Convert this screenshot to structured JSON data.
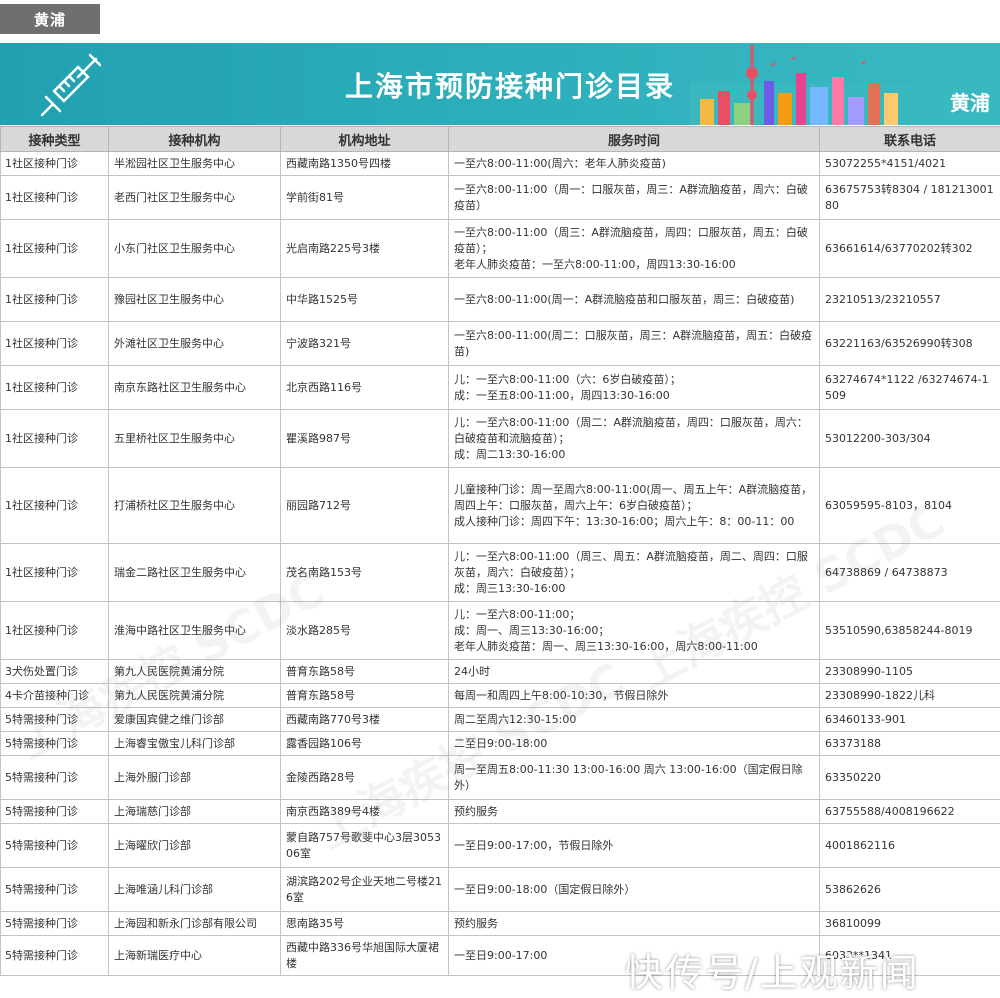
{
  "tab": {
    "label": "黄浦"
  },
  "banner": {
    "title": "上海市预防接种门诊目录",
    "district": "黄浦"
  },
  "table": {
    "headers": [
      "接种类型",
      "接种机构",
      "机构地址",
      "服务时间",
      "联系电话"
    ],
    "rows": [
      {
        "type": "1社区接种门诊",
        "org": "半淞园社区卫生服务中心",
        "addr": "西藏南路1350号四楼",
        "hours": "一至六8:00-11:00(周六：老年人肺炎疫苗)",
        "phone": "53072255*4151/4021"
      },
      {
        "type": "1社区接种门诊",
        "org": "老西门社区卫生服务中心",
        "addr": "学前街81号",
        "hours": "一至六8:00-11:00（周一：口服灰苗，周三：A群流脑疫苗，周六：白破疫苗）",
        "phone": "63675753转8304 / 18121300180"
      },
      {
        "type": "1社区接种门诊",
        "org": "小东门社区卫生服务中心",
        "addr": "光启南路225号3楼",
        "hours": "一至六8:00-11:00（周三：A群流脑疫苗，周四：口服灰苗，周五：白破疫苗）；\n老年人肺炎疫苗：一至六8:00-11:00，周四13:30-16:00",
        "phone": "63661614/63770202转302"
      },
      {
        "type": "1社区接种门诊",
        "org": "豫园社区卫生服务中心",
        "addr": "中华路1525号",
        "hours": "一至六8:00-11:00(周一：A群流脑疫苗和口服灰苗，周三：白破疫苗)",
        "phone": "23210513/23210557"
      },
      {
        "type": "1社区接种门诊",
        "org": "外滩社区卫生服务中心",
        "addr": "宁波路321号",
        "hours": "一至六8:00-11:00(周二：口服灰苗，周三：A群流脑疫苗，周五：白破疫苗)",
        "phone": "63221163/63526990转308"
      },
      {
        "type": "1社区接种门诊",
        "org": "南京东路社区卫生服务中心",
        "addr": "北京西路116号",
        "hours": "儿：一至六8:00-11:00（六：6岁白破疫苗）；\n成：一至五8:00-11:00，周四13:30-16:00",
        "phone": "63274674*1122 /63274674-1509"
      },
      {
        "type": "1社区接种门诊",
        "org": "五里桥社区卫生服务中心",
        "addr": "瞿溪路987号",
        "hours": "儿：一至六8:00-11:00（周二：A群流脑疫苗，周四：口服灰苗，周六：白破疫苗和流脑疫苗）；\n成：周二13:30-16:00",
        "phone": "53012200-303/304"
      },
      {
        "type": "1社区接种门诊",
        "org": "打浦桥社区卫生服务中心",
        "addr": "丽园路712号",
        "hours": "儿童接种门诊：周一至周六8:00-11:00(周一、周五上午：A群流脑疫苗，周四上午：口服灰苗，周六上午：6岁白破疫苗）；\n成人接种门诊：周四下午：13:30-16:00；周六上午：8：00-11：00",
        "phone": "63059595-8103，8104"
      },
      {
        "type": "1社区接种门诊",
        "org": "瑞金二路社区卫生服务中心",
        "addr": "茂名南路153号",
        "hours": "儿：一至六8:00-11:00（周三、周五：A群流脑疫苗，周二、周四：口服灰苗，周六：白破疫苗）；\n成：周三13:30-16:00",
        "phone": "64738869 / 64738873"
      },
      {
        "type": "1社区接种门诊",
        "org": "淮海中路社区卫生服务中心",
        "addr": "淡水路285号",
        "hours": "儿：一至六8:00-11:00；\n成：周一、周三13:30-16:00；\n老年人肺炎疫苗：周一、周三13:30-16:00，周六8:00-11:00",
        "phone": "53510590,63858244-8019"
      },
      {
        "type": "3犬伤处置门诊",
        "org": "第九人民医院黄浦分院",
        "addr": "普育东路58号",
        "hours": "24小时",
        "phone": "23308990-1105"
      },
      {
        "type": "4卡介苗接种门诊",
        "org": "第九人民医院黄浦分院",
        "addr": "普育东路58号",
        "hours": "每周一和周四上午8:00-10:30，节假日除外",
        "phone": "23308990-1822儿科"
      },
      {
        "type": "5特需接种门诊",
        "org": "爱康国宾健之维门诊部",
        "addr": "西藏南路770号3楼",
        "hours": "周二至周六12:30-15:00",
        "phone": "63460133-901"
      },
      {
        "type": "5特需接种门诊",
        "org": "上海睿宝傲宝儿科门诊部",
        "addr": "露香园路106号",
        "hours": "二至日9:00-18:00",
        "phone": "63373188"
      },
      {
        "type": "5特需接种门诊",
        "org": "上海外服门诊部",
        "addr": "金陵西路28号",
        "hours": "周一至周五8:00-11:30 13:00-16:00 周六 13:00-16:00（国定假日除外）",
        "phone": "63350220"
      },
      {
        "type": "5特需接种门诊",
        "org": "上海瑞慈门诊部",
        "addr": "南京西路389号4楼",
        "hours": "预约服务",
        "phone": "63755588/4008196622"
      },
      {
        "type": "5特需接种门诊",
        "org": "上海曜欣门诊部",
        "addr": "蒙自路757号歌斐中心3层305306室",
        "hours": "一至日9:00-17:00，节假日除外",
        "phone": "4001862116"
      },
      {
        "type": "5特需接种门诊",
        "org": "上海唯涵儿科门诊部",
        "addr": "湖滨路202号企业天地二号楼216室",
        "hours": "一至日9:00-18:00（国定假日除外）",
        "phone": "53862626"
      },
      {
        "type": "5特需接种门诊",
        "org": "上海园和新永门诊部有限公司",
        "addr": "思南路35号",
        "hours": "预约服务",
        "phone": "36810099"
      },
      {
        "type": "5特需接种门诊",
        "org": "上海新瑞医疗中心",
        "addr": "西藏中路336号华旭国际大厦裙楼",
        "hours": "一至日9:00-17:00",
        "phone": "6033**1341"
      }
    ]
  },
  "watermark": {
    "text": "上海疾控 SCDC"
  },
  "footer_watermark": {
    "text": "快传号/上观新闻"
  },
  "colors": {
    "banner": "#2aa9b8",
    "tab": "#6f6f6f",
    "header_bg": "#d8d8d8",
    "border": "#c4c4c4"
  }
}
